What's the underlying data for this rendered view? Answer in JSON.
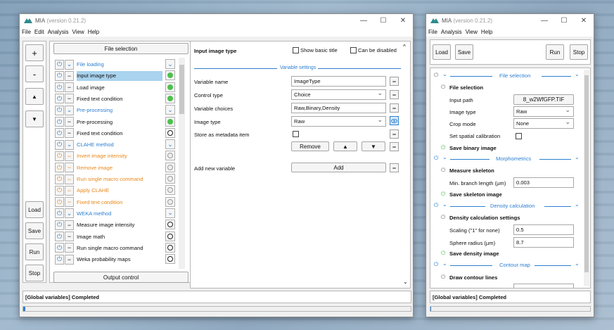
{
  "left_window": {
    "title": "MIA",
    "version": "(version 0.21.2)",
    "menu": [
      "File",
      "Edit",
      "Analysis",
      "View",
      "Help"
    ],
    "window_buttons": [
      "—",
      "☐",
      "✕"
    ],
    "side_buttons": {
      "add": "+",
      "remove": "-",
      "up": "▲",
      "down": "▼",
      "load": "Load",
      "save": "Save",
      "run": "Run",
      "stop": "Stop"
    },
    "file_selection": "File selection",
    "output_control": "Output control",
    "modules": [
      {
        "name": "File loading",
        "kind": "group",
        "icon": "chevron",
        "status": "blue-chevron"
      },
      {
        "name": "Input image type",
        "kind": "selected",
        "icon": "minus",
        "status": "green"
      },
      {
        "name": "Load image",
        "kind": "normal",
        "icon": "minus",
        "status": "green"
      },
      {
        "name": "Fixed text condition",
        "kind": "normal",
        "icon": "minus",
        "status": "green"
      },
      {
        "name": "Pre-processing",
        "kind": "group",
        "icon": "chevron",
        "status": "blue-chevron"
      },
      {
        "name": "Pre-processing",
        "kind": "normal",
        "icon": "minus",
        "status": "green"
      },
      {
        "name": "Fixed text condition",
        "kind": "normal",
        "icon": "minus",
        "status": "black"
      },
      {
        "name": "CLAHE method",
        "kind": "group",
        "icon": "chevron",
        "status": "blue-chevron"
      },
      {
        "name": "Invert image intensity",
        "kind": "disabled",
        "icon": "minus",
        "status": "grey"
      },
      {
        "name": "Remove image",
        "kind": "disabled",
        "icon": "minus",
        "status": "grey"
      },
      {
        "name": "Run single macro command",
        "kind": "disabled",
        "icon": "minus",
        "status": "grey"
      },
      {
        "name": "Apply CLAHE",
        "kind": "disabled",
        "icon": "minus",
        "status": "grey"
      },
      {
        "name": "Fixed text condition",
        "kind": "disabled",
        "icon": "minus",
        "status": "grey"
      },
      {
        "name": "WEKA method",
        "kind": "group",
        "icon": "chevron",
        "status": "blue-chevron"
      },
      {
        "name": "Measure image intensity",
        "kind": "normal",
        "icon": "minus",
        "status": "black"
      },
      {
        "name": "Image math",
        "kind": "normal",
        "icon": "minus",
        "status": "black"
      },
      {
        "name": "Run single macro command",
        "kind": "normal",
        "icon": "minus",
        "status": "black"
      },
      {
        "name": "Weka probability maps",
        "kind": "normal",
        "icon": "minus",
        "status": "black"
      }
    ],
    "params": {
      "heading": "Input image type",
      "show_basic_title": "Show basic title",
      "can_be_disabled": "Can be disabled",
      "variable_settings": "Variable settings",
      "variable_name_label": "Variable name",
      "variable_name_value": "ImageType",
      "control_type_label": "Control type",
      "control_type_value": "Choice",
      "variable_choices_label": "Variable choices",
      "variable_choices_value": "Raw,Binary,Density",
      "image_type_label": "Image type",
      "image_type_value": "Raw",
      "store_metadata_label": "Store as metadata item",
      "remove_label": "Remove",
      "up_label": "▲",
      "down_label": "▼",
      "add_new_variable_label": "Add new variable",
      "add_label": "Add"
    },
    "status": "[Global variables] Completed"
  },
  "right_window": {
    "title": "MIA",
    "version": "(version 0.21.2)",
    "menu": [
      "File",
      "Analysis",
      "View",
      "Help"
    ],
    "window_buttons": [
      "—",
      "☐",
      "✕"
    ],
    "toolbar": {
      "load": "Load",
      "save": "Save",
      "run": "Run",
      "stop": "Stop"
    },
    "sections": {
      "file_selection": "File selection",
      "morphometrics": "Morphometrics",
      "density_calculation": "Density calculation",
      "contour_map": "Contour map"
    },
    "items": {
      "file_selection": "File selection",
      "input_path_label": "Input path",
      "input_path_value": "8_w2WfGFP.TIF",
      "image_type_label": "Image type",
      "image_type_value": "Raw",
      "crop_mode_label": "Crop mode",
      "crop_mode_value": "None",
      "spatial_calibration_label": "Set spatial calibration",
      "save_binary_image": "Save binary image",
      "measure_skeleton": "Measure skeleton",
      "min_branch_label": "Min. branch length (µm)",
      "min_branch_value": "0.003",
      "save_skeleton_image": "Save skeleton image",
      "density_settings": "Density calculation settings",
      "scaling_label": "Scaling (\"1\" for none)",
      "scaling_value": "0.5",
      "sphere_radius_label": "Sphere radius (µm)",
      "sphere_radius_value": "8.7",
      "save_density_image": "Save density image",
      "draw_contour_lines": "Draw contour lines"
    },
    "status": "[Global variables] Completed"
  },
  "colors": {
    "accent": "#2d7fd1",
    "selected": "#a9d3ee",
    "disabled": "#e88a1c",
    "ok": "#4cc14c"
  }
}
